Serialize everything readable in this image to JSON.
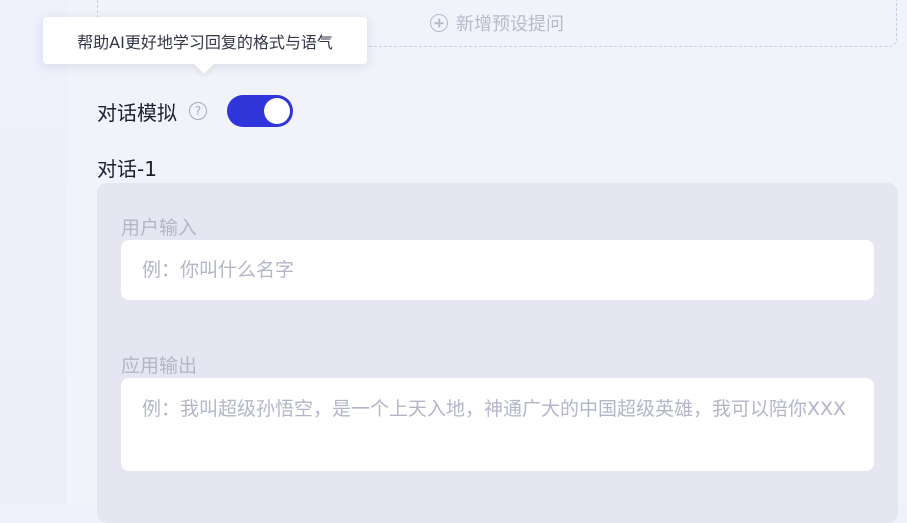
{
  "add_preset": {
    "label": "新增预设提问",
    "icon": "plus-circle-icon"
  },
  "tooltip": {
    "text": "帮助AI更好地学习回复的格式与语气"
  },
  "dialog_simulation": {
    "label": "对话模拟",
    "help_icon": "question-circle-icon",
    "help_glyph": "?",
    "enabled": true,
    "toggle_color": "#2f35d9"
  },
  "dialog": {
    "title": "对话-1",
    "user_input": {
      "label": "用户输入",
      "placeholder": "例：你叫什么名字"
    },
    "app_output": {
      "label": "应用输出",
      "placeholder": "例：我叫超级孙悟空，是一个上天入地，神通广大的中国超级英雄，我可以陪你XXX"
    }
  }
}
